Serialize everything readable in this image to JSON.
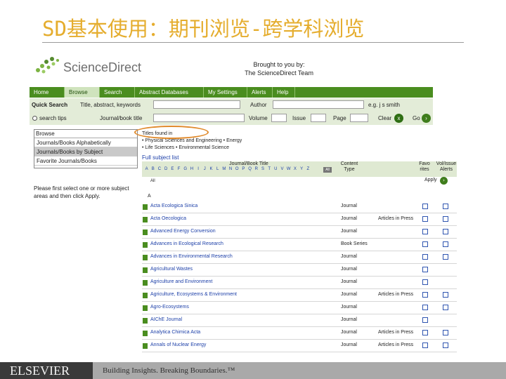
{
  "slide": {
    "title": "SD基本使用：期刊浏览-跨学科浏览"
  },
  "header": {
    "logo_text": "ScienceDirect",
    "brought_line1": "Brought to you by:",
    "brought_line2": "The ScienceDirect Team"
  },
  "nav": {
    "items": [
      {
        "label": "Home"
      },
      {
        "label": "Browse",
        "active": true
      },
      {
        "label": "Search"
      },
      {
        "label": "Abstract Databases"
      },
      {
        "label": "My Settings"
      },
      {
        "label": "Alerts"
      },
      {
        "label": "Help"
      }
    ]
  },
  "quick_search": {
    "label": "Quick Search",
    "title_label": "Title, abstract, keywords",
    "author_label": "Author",
    "author_hint": "e.g. j s smith",
    "radio_label": "search tips",
    "journal_label": "Journal/book title",
    "volume_label": "Volume",
    "issue_label": "Issue",
    "page_label": "Page",
    "clear_label": "Clear",
    "clear_icon": "x",
    "go_label": "Go",
    "go_icon": "›"
  },
  "browse_panel": {
    "heading": "Browse",
    "items": [
      {
        "label": "Journals/Books Alphabetically"
      },
      {
        "label": "Journals/Books by Subject",
        "selected": true
      },
      {
        "label": "Favorite Journals/Books"
      }
    ],
    "hint": "Please first select one or more subject areas and then click Apply."
  },
  "titles_in": {
    "line1": "Titles found in",
    "line2": "• Physical Sciences and Engineering • Energy",
    "line3": "• Life Sciences • Environmental Science",
    "full_list": "Full subject list"
  },
  "table": {
    "letters": [
      "A",
      "B",
      "C",
      "D",
      "E",
      "F",
      "G",
      "H",
      "I",
      "J",
      "K",
      "L",
      "M",
      "N",
      "O",
      "P",
      "Q",
      "R",
      "S",
      "T",
      "U",
      "V",
      "W",
      "X",
      "Y",
      "Z",
      "All"
    ],
    "col_title": "Journal/Book Title",
    "col_type_line1": "Content",
    "col_type_line2": "Type",
    "col_fav_line1": "Favo",
    "col_fav_line2": "rites",
    "col_alerts_line1": "Vol/Issue",
    "col_alerts_line2": "Alerts",
    "all_label": "All",
    "apply_label": "Apply",
    "apply_icon": "›",
    "section_letter": "A",
    "rows": [
      {
        "title": "Acta Ecologica Sinica",
        "type": "Journal",
        "aip": "",
        "fav": true,
        "alert": true
      },
      {
        "title": "Acta Oecologica",
        "type": "Journal",
        "aip": "Articles in Press",
        "fav": true,
        "alert": true
      },
      {
        "title": "Advanced Energy Conversion",
        "type": "Journal",
        "aip": "",
        "fav": true,
        "alert": true
      },
      {
        "title": "Advances in Ecological Research",
        "type": "Book Series",
        "aip": "",
        "fav": true,
        "alert": true
      },
      {
        "title": "Advances in Environmental Research",
        "type": "Journal",
        "aip": "",
        "fav": true,
        "alert": true
      },
      {
        "title": "Agricultural Wastes",
        "type": "Journal",
        "aip": "",
        "fav": true,
        "alert": false
      },
      {
        "title": "Agriculture and Environment",
        "type": "Journal",
        "aip": "",
        "fav": true,
        "alert": false
      },
      {
        "title": "Agriculture, Ecosystems & Environment",
        "type": "Journal",
        "aip": "Articles in Press",
        "fav": true,
        "alert": true
      },
      {
        "title": "Agro-Ecosystems",
        "type": "Journal",
        "aip": "",
        "fav": true,
        "alert": true
      },
      {
        "title": "AIChE Journal",
        "type": "Journal",
        "aip": "",
        "fav": true,
        "alert": false
      },
      {
        "title": "Analytica Chimica Acta",
        "type": "Journal",
        "aip": "Articles in Press",
        "fav": true,
        "alert": true
      },
      {
        "title": "Annals of Nuclear Energy",
        "type": "Journal",
        "aip": "Articles in Press",
        "fav": true,
        "alert": true
      }
    ]
  },
  "footer": {
    "logo": "ELSEVIER",
    "tagline": "Building Insights. Breaking Boundaries.™"
  },
  "colors": {
    "title": "#e5ad2e",
    "nav_green": "#4a8d1f",
    "highlight_oval": "#e08a2c",
    "link_blue": "#1c3fa8"
  }
}
